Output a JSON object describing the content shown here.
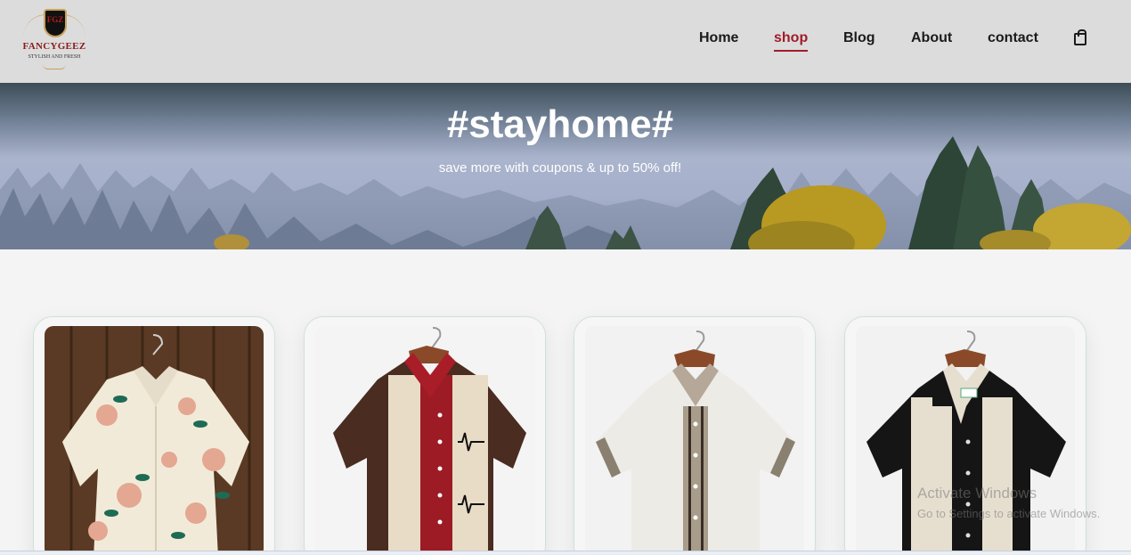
{
  "brand": {
    "name": "FANCYGEEZ",
    "tagline": "STYLISH AND FRESH",
    "monogram": "FGZ"
  },
  "nav": {
    "items": [
      {
        "label": "Home",
        "active": false
      },
      {
        "label": "shop",
        "active": true
      },
      {
        "label": "Blog",
        "active": false
      },
      {
        "label": "About",
        "active": false
      },
      {
        "label": "contact",
        "active": false
      }
    ],
    "cart_icon": "shopping-bag-icon"
  },
  "hero": {
    "title": "#stayhome#",
    "subtitle": "save more with coupons & up to 50% off!"
  },
  "products": [
    {
      "image": "floral-shirt-image"
    },
    {
      "image": "red-stripe-music-shirt-image"
    },
    {
      "image": "white-stripe-shirt-image"
    },
    {
      "image": "black-cream-stripe-shirt-image"
    }
  ],
  "watermark": {
    "line1": "Activate Windows",
    "line2": "Go to Settings to activate Windows."
  },
  "colors": {
    "accent": "#a11c2a",
    "header_bg": "#dcdcdc"
  }
}
